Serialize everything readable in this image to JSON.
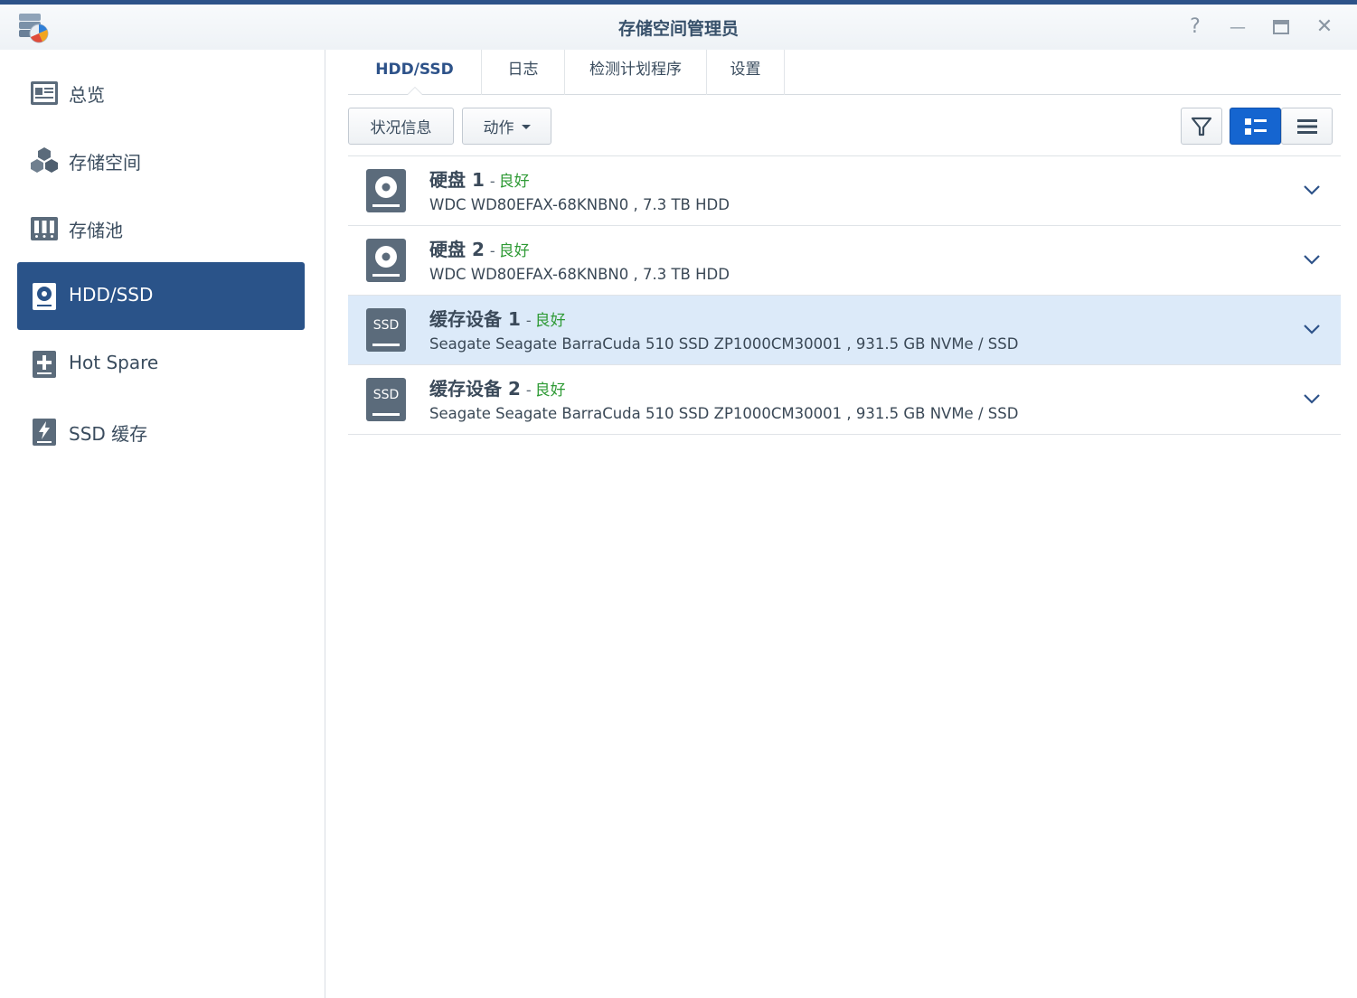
{
  "window": {
    "title": "存储空间管理员",
    "help_glyph": "?",
    "minimize_glyph": "—",
    "close_glyph": "✕"
  },
  "sidebar": {
    "items": [
      {
        "label": "总览",
        "icon": "overview-icon",
        "active": false
      },
      {
        "label": "存储空间",
        "icon": "storage-cubes-icon",
        "active": false
      },
      {
        "label": "存储池",
        "icon": "storage-pool-icon",
        "active": false
      },
      {
        "label": "HDD/SSD",
        "icon": "hdd-icon",
        "active": true
      },
      {
        "label": "Hot Spare",
        "icon": "hot-spare-icon",
        "active": false
      },
      {
        "label": "SSD 缓存",
        "icon": "ssd-cache-icon",
        "active": false
      }
    ]
  },
  "tabs": [
    {
      "label": "HDD/SSD",
      "active": true
    },
    {
      "label": "日志",
      "active": false
    },
    {
      "label": "检测计划程序",
      "active": false
    },
    {
      "label": "设置",
      "active": false
    }
  ],
  "toolbar": {
    "status_label": "状况信息",
    "action_label": "动作",
    "filter_icon": "filter-icon",
    "detail_view_icon": "detail-view-icon",
    "list_view_icon": "list-view-icon",
    "active_view": "detail"
  },
  "disks": [
    {
      "name": "硬盘",
      "number": "1",
      "status": "良好",
      "desc": "WDC WD80EFAX-68KNBN0 , 7.3 TB HDD",
      "icon": "hdd-disk-icon",
      "selected": false
    },
    {
      "name": "硬盘",
      "number": "2",
      "status": "良好",
      "desc": "WDC WD80EFAX-68KNBN0 , 7.3 TB HDD",
      "icon": "hdd-disk-icon",
      "selected": false
    },
    {
      "name": "缓存设备",
      "number": "1",
      "status": "良好",
      "desc": "Seagate Seagate BarraCuda 510 SSD ZP1000CM30001 , 931.5 GB NVMe / SSD",
      "icon": "ssd-disk-icon",
      "icon_text": "SSD",
      "selected": true
    },
    {
      "name": "缓存设备",
      "number": "2",
      "status": "良好",
      "desc": "Seagate Seagate BarraCuda 510 SSD ZP1000CM30001 , 931.5 GB NVMe / SSD",
      "icon": "ssd-disk-icon",
      "icon_text": "SSD",
      "selected": false
    }
  ],
  "colors": {
    "accent": "#2a5389",
    "status_good": "#2e9a35",
    "selected_row": "#dceaf9",
    "view_button_active": "#1565d0"
  }
}
